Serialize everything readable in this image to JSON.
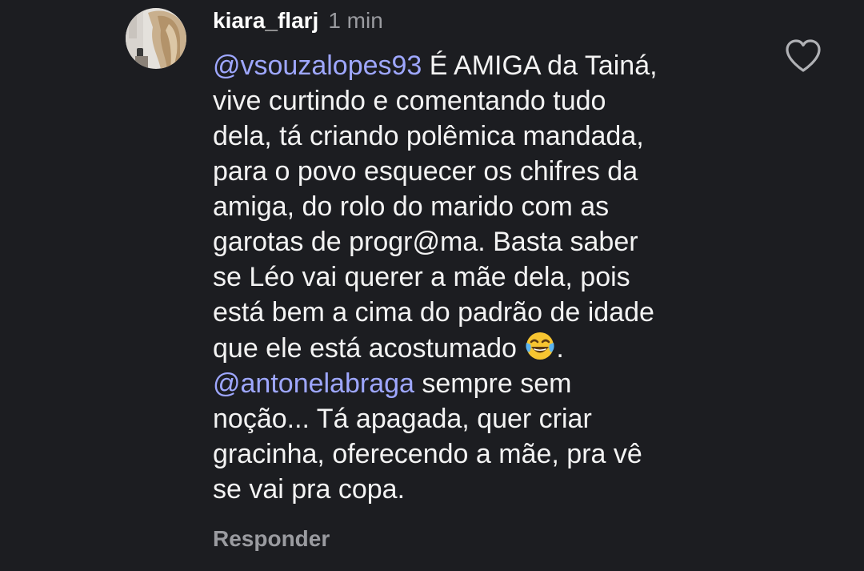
{
  "comment": {
    "username": "kiara_flarj",
    "time": "1 min",
    "lines": [
      {
        "mention": "@vsouzalopes93",
        "text": " É AMIGA da Tainá,"
      },
      {
        "text": "vive curtindo e comentando tudo"
      },
      {
        "text": "dela, tá criando polêmica mandada,"
      },
      {
        "text": "para o povo esquecer os chifres da"
      },
      {
        "text": "amiga, do rolo do marido com as"
      },
      {
        "text": "garotas de progr@ma. Basta saber"
      },
      {
        "text": "se Léo vai querer a mãe dela, pois"
      },
      {
        "text": "está bem a cima do padrão de idade"
      },
      {
        "text": "que ele está acostumado ",
        "emoji": "laughing-crying-emoji",
        "after": "."
      },
      {
        "mention": "@antonelabraga",
        "text": " sempre sem"
      },
      {
        "text": "noção... Tá apagada, quer criar"
      },
      {
        "text": "gracinha, oferecendo a mãe, pra vê"
      },
      {
        "text": "se vai pra copa."
      }
    ],
    "reply_label": "Responder",
    "like_icon": "heart-outline-icon"
  },
  "colors": {
    "background": "#1c1d21",
    "mention": "#9ea7ff",
    "muted": "#9a9ba0"
  }
}
